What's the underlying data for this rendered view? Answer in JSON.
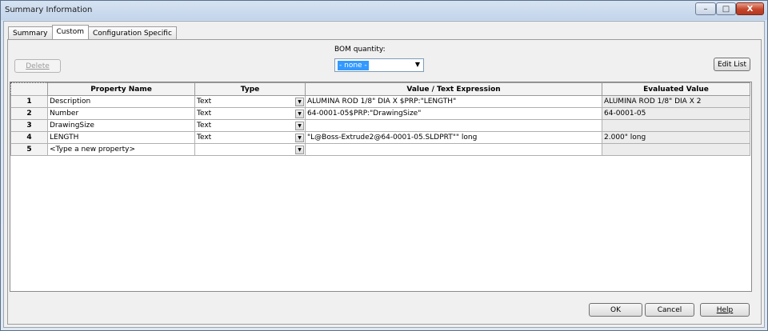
{
  "window": {
    "title": "Summary Information",
    "minimize_label": "–",
    "maximize_label": "□",
    "close_label": "X"
  },
  "tabs": [
    {
      "label": "Summary",
      "active": false
    },
    {
      "label": "Custom",
      "active": true
    },
    {
      "label": "Configuration Specific",
      "active": false
    }
  ],
  "toolbar": {
    "delete_label": "Delete",
    "edit_list_label": "Edit List",
    "bom_quantity_label": "BOM quantity:",
    "bom_quantity_value": "- none -"
  },
  "table": {
    "headers": [
      "Property Name",
      "Type",
      "Value / Text Expression",
      "Evaluated Value"
    ],
    "rows": [
      {
        "num": "1",
        "name": "Description",
        "type": "Text",
        "value": "ALUMINA ROD 1/8\"  DIA X $PRP:\"LENGTH\"",
        "evaluated": "ALUMINA ROD 1/8\"  DIA X 2"
      },
      {
        "num": "2",
        "name": "Number",
        "type": "Text",
        "value": "64-0001-05$PRP:\"DrawingSize\"",
        "evaluated": "64-0001-05"
      },
      {
        "num": "3",
        "name": "DrawingSize",
        "type": "Text",
        "value": "",
        "evaluated": ""
      },
      {
        "num": "4",
        "name": "LENGTH",
        "type": "Text",
        "value": "\"L@Boss-Extrude2@64-0001-05.SLDPRT\"\" long",
        "evaluated": "2.000\" long"
      },
      {
        "num": "5",
        "name": "<Type a new property>",
        "type": "",
        "value": "",
        "evaluated": ""
      }
    ]
  },
  "footer": {
    "ok_label": "OK",
    "cancel_label": "Cancel",
    "help_label": "Help"
  }
}
